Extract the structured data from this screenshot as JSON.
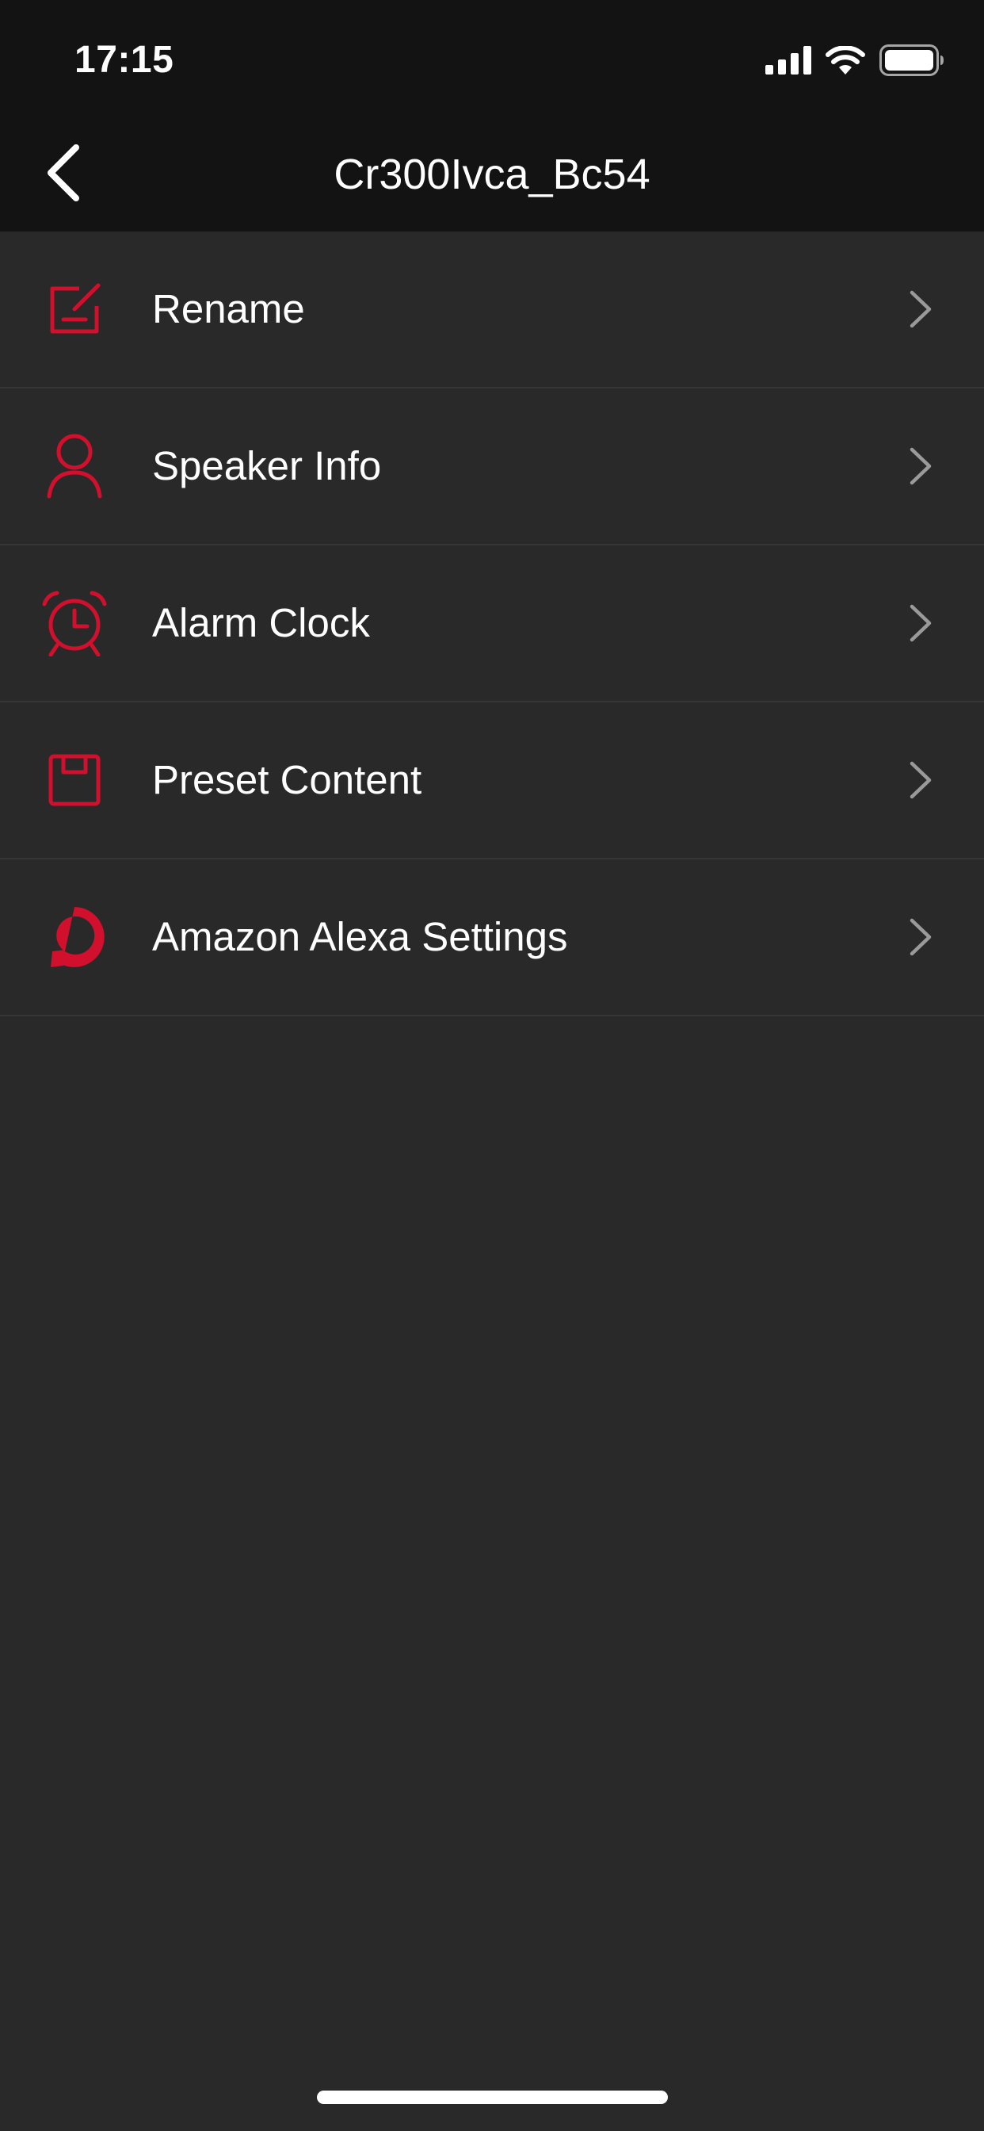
{
  "status_bar": {
    "time": "17:15",
    "icons": [
      "cellular-signal-icon",
      "wifi-icon",
      "battery-icon"
    ]
  },
  "nav": {
    "back_icon": "chevron-left-icon",
    "title": "Cr300Ivca_Bc54"
  },
  "menu": {
    "items": [
      {
        "label": "Rename",
        "icon": "edit-icon"
      },
      {
        "label": "Speaker Info",
        "icon": "person-icon"
      },
      {
        "label": "Alarm Clock",
        "icon": "alarm-clock-icon"
      },
      {
        "label": "Preset Content",
        "icon": "save-icon"
      },
      {
        "label": "Amazon Alexa Settings",
        "icon": "alexa-icon"
      }
    ]
  },
  "colors": {
    "accent": "#d0102d",
    "background": "#292929",
    "bar_background": "#131313",
    "divider": "#353535",
    "chevron": "#9a9a9a"
  }
}
